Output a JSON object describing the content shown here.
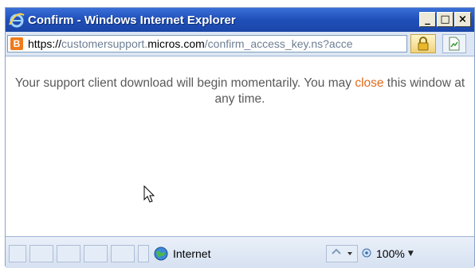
{
  "window": {
    "title": "Confirm - Windows Internet Explorer",
    "buttons": {
      "minimize": "_",
      "maximize": "□",
      "close": "×"
    }
  },
  "address": {
    "site_icon_letter": "B",
    "url_protocol": "https://",
    "url_subdomain": "customersupport.",
    "url_domain": "micros.com",
    "url_path": "/confirm_access_key.ns?acce"
  },
  "content": {
    "message_before": "Your support client download will begin momentarily. You may ",
    "close_link": "close",
    "message_after": " this window at any time."
  },
  "status": {
    "zone": "Internet",
    "zoom": "100%"
  },
  "colors": {
    "link": "#e06a1c",
    "titlebar": "#1f4fb8",
    "message": "#595959"
  }
}
